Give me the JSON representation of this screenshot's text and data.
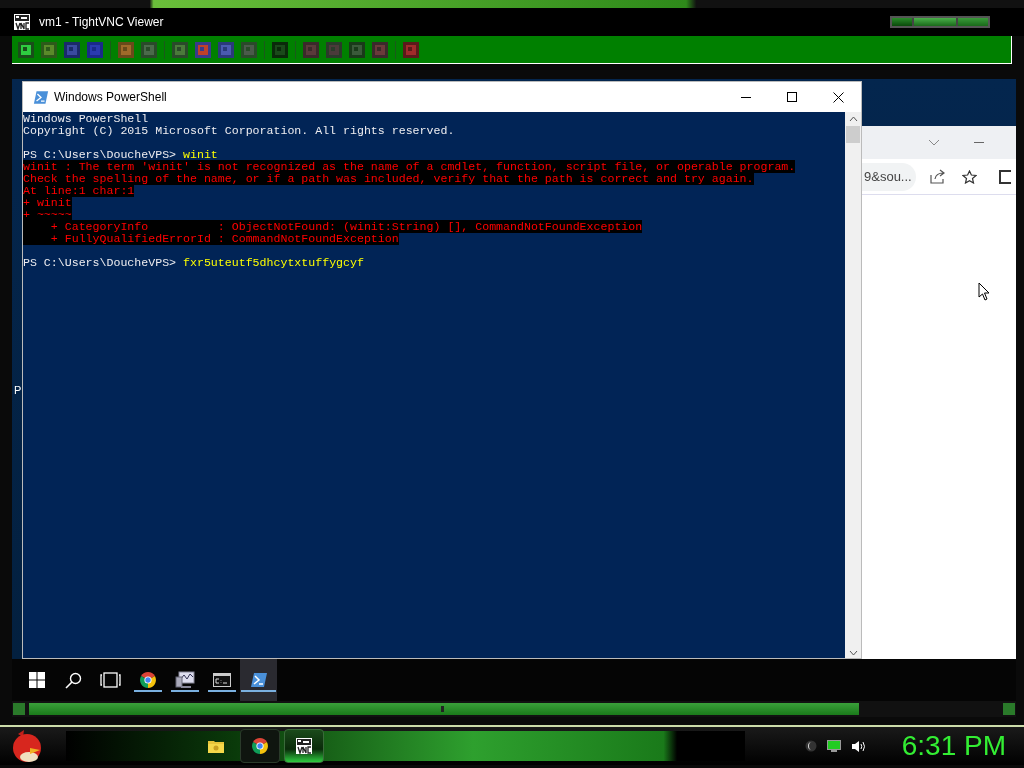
{
  "viewer": {
    "title": "vm1 - TightVNC Viewer"
  },
  "powershell": {
    "title": "Windows PowerShell",
    "lines": [
      {
        "kind": "output",
        "text": "Windows PowerShell"
      },
      {
        "kind": "output",
        "text": "Copyright (C) 2015 Microsoft Corporation. All rights reserved."
      },
      {
        "kind": "blank"
      },
      {
        "kind": "command",
        "prompt": "PS C:\\Users\\DoucheVPS>",
        "text": "winit"
      },
      {
        "kind": "error",
        "text": "winit : The term 'winit' is not recognized as the name of a cmdlet, function, script file, or operable program."
      },
      {
        "kind": "error",
        "text": "Check the spelling of the name, or if a path was included, verify that the path is correct and try again."
      },
      {
        "kind": "error",
        "text": "At line:1 char:1"
      },
      {
        "kind": "error",
        "text": "+ winit"
      },
      {
        "kind": "error",
        "text": "+ ~~~~~"
      },
      {
        "kind": "error",
        "text": "    + CategoryInfo          : ObjectNotFound: (winit:String) [], CommandNotFoundException"
      },
      {
        "kind": "error",
        "text": "    + FullyQualifiedErrorId : CommandNotFoundException"
      },
      {
        "kind": "blank"
      },
      {
        "kind": "command",
        "prompt": "PS C:\\Users\\DoucheVPS>",
        "text": "fxr5uteutf5dhcytxtuffygcyf"
      }
    ]
  },
  "browser": {
    "address": "9&sou..."
  },
  "desktop": {
    "edge_text": "P"
  },
  "remote_taskbar": [
    {
      "kind": "start"
    },
    {
      "kind": "search"
    },
    {
      "kind": "taskview"
    },
    {
      "kind": "chrome",
      "selected": false
    },
    {
      "kind": "monitor",
      "selected": false
    },
    {
      "kind": "cmd",
      "selected": false
    },
    {
      "kind": "powershell",
      "selected": true
    }
  ],
  "host_taskbar": {
    "apps": [
      {
        "kind": "folder",
        "selected": false
      },
      {
        "kind": "chrome",
        "selected": false
      },
      {
        "kind": "vnc",
        "selected": true
      }
    ],
    "clock": "6:31 PM"
  }
}
